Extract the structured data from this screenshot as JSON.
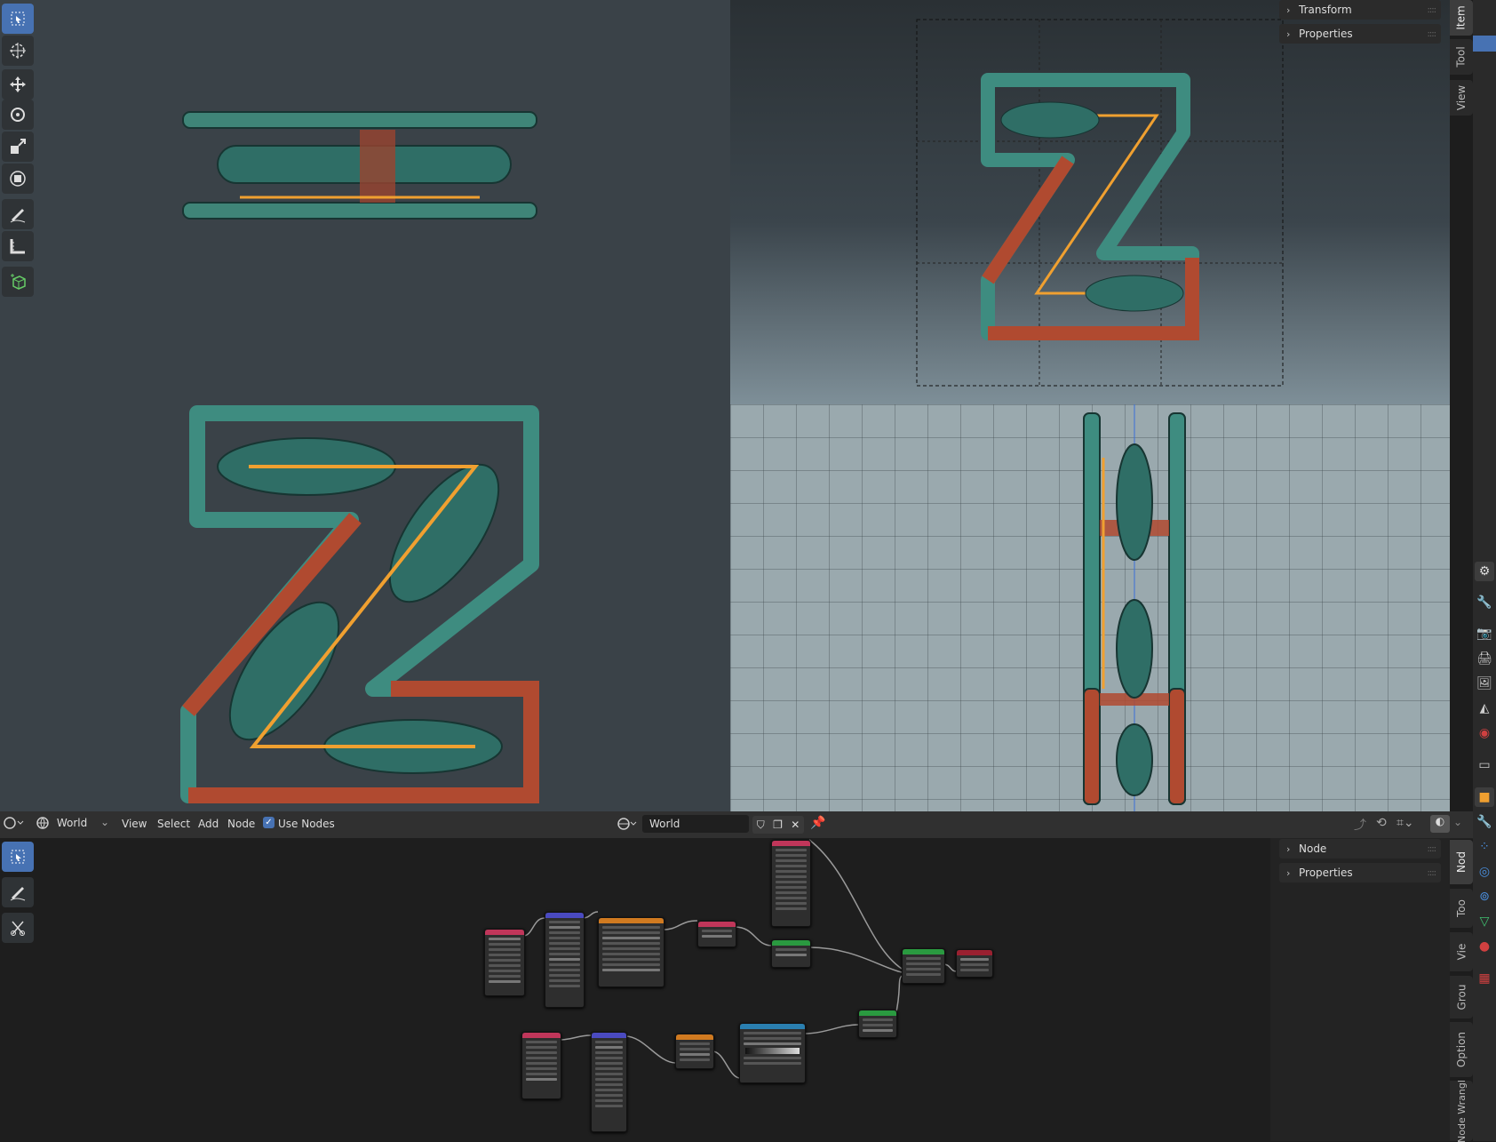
{
  "viewport": {
    "sidebar_tabs": [
      "Item",
      "Tool",
      "View"
    ],
    "panels": [
      {
        "label": "Transform"
      },
      {
        "label": "Properties"
      }
    ]
  },
  "tools": [
    {
      "name": "select-box-icon",
      "active": true
    },
    {
      "name": "cursor-icon",
      "active": false
    },
    {
      "name": "move-icon",
      "active": false
    },
    {
      "name": "rotate-icon",
      "active": false
    },
    {
      "name": "scale-icon",
      "active": false
    },
    {
      "name": "transform-icon",
      "active": false
    },
    {
      "name": "annotate-icon",
      "active": false
    },
    {
      "name": "measure-icon",
      "active": false
    },
    {
      "name": "add-cube-icon",
      "active": false
    }
  ],
  "node_editor": {
    "header": {
      "context": "World",
      "menus": [
        "View",
        "Select",
        "Add",
        "Node"
      ],
      "use_nodes_label": "Use Nodes",
      "use_nodes_checked": true,
      "world_name": "World"
    },
    "sidebar_panels": [
      {
        "label": "Node"
      },
      {
        "label": "Properties"
      }
    ],
    "sidebar_tabs": [
      "Nod",
      "Too",
      "Vie",
      "Grou",
      "Option",
      "Node Wrangl"
    ],
    "tools": [
      "select-box-icon",
      "annotate-icon",
      "cut-links-icon"
    ]
  },
  "colors": {
    "accent": "#4772b3",
    "teal": "#3e8c80",
    "rust": "#b04a30",
    "highlight": "#f0a030"
  }
}
